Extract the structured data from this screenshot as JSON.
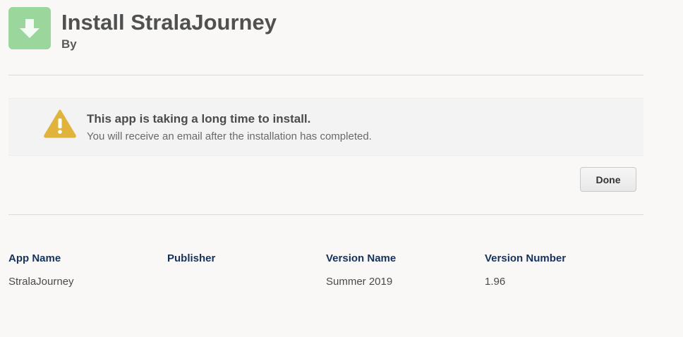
{
  "header": {
    "title": "Install StralaJourney",
    "subtitle": "By",
    "icon": "download-arrow-icon",
    "icon_color": "#9bd69d"
  },
  "alert": {
    "icon": "warning-icon",
    "icon_color": "#e0b33d",
    "title": "This app is taking a long time to install.",
    "message": "You will receive an email after the installation has completed."
  },
  "actions": {
    "done_label": "Done"
  },
  "details": {
    "columns": [
      {
        "header": "App Name",
        "value": "StralaJourney"
      },
      {
        "header": "Publisher",
        "value": ""
      },
      {
        "header": "Version Name",
        "value": "Summer 2019"
      },
      {
        "header": "Version Number",
        "value": "1.96"
      }
    ]
  }
}
